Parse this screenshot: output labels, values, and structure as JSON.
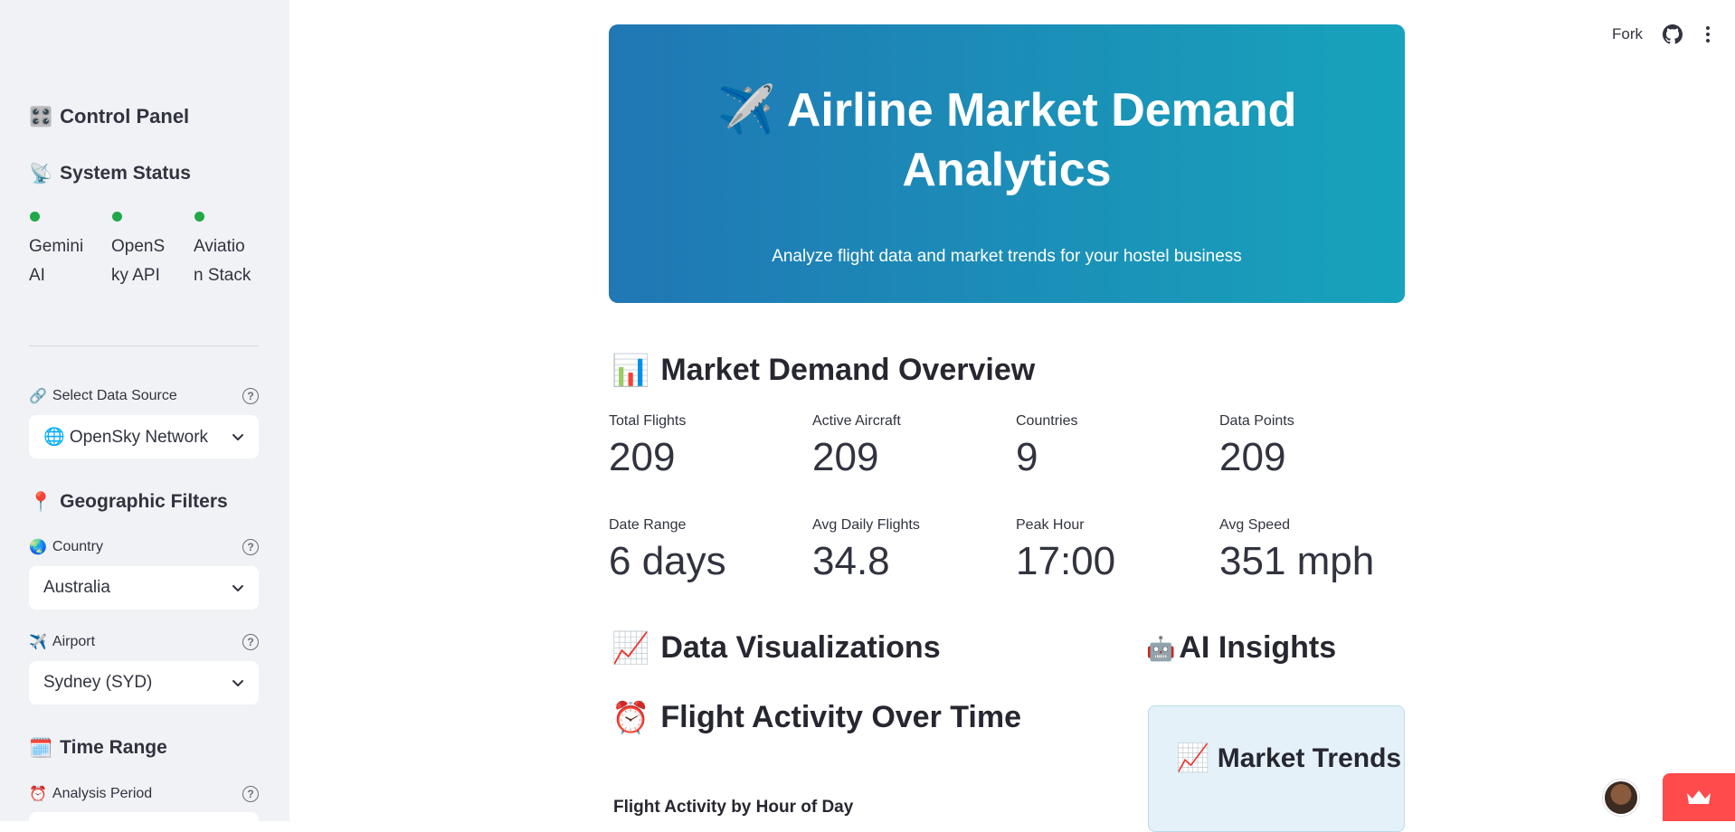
{
  "topbar": {
    "fork_label": "Fork"
  },
  "sidebar": {
    "title": "Control Panel",
    "title_icon": "🎛️",
    "system_status": {
      "heading": "System Status",
      "icon": "📡",
      "items": [
        {
          "label": "Gemini AI",
          "status_color": "#21a849"
        },
        {
          "label": "OpenSky API",
          "status_color": "#21a849"
        },
        {
          "label": "Aviation Stack",
          "status_color": "#21a849"
        }
      ]
    },
    "data_source": {
      "label": "Select Data Source",
      "icon": "🔗",
      "value": "🌐 OpenSky Network"
    },
    "geo": {
      "heading": "Geographic Filters",
      "icon": "📍",
      "country": {
        "label": "Country",
        "icon": "🌏",
        "value": "Australia"
      },
      "airport": {
        "label": "Airport",
        "icon": "✈️",
        "value": "Sydney (SYD)"
      }
    },
    "time": {
      "heading": "Time Range",
      "icon": "🗓️",
      "period": {
        "label": "Analysis Period",
        "icon": "⏰"
      }
    }
  },
  "hero": {
    "title": "✈️ Airline Market Demand Analytics",
    "subtitle": "Analyze flight data and market trends for your hostel business"
  },
  "overview": {
    "heading": "Market Demand Overview",
    "icon": "📊",
    "metrics": [
      {
        "label": "Total Flights",
        "value": "209"
      },
      {
        "label": "Active Aircraft",
        "value": "209"
      },
      {
        "label": "Countries",
        "value": "9"
      },
      {
        "label": "Data Points",
        "value": "209"
      },
      {
        "label": "Date Range",
        "value": "6 days"
      },
      {
        "label": "Avg Daily Flights",
        "value": "34.8"
      },
      {
        "label": "Peak Hour",
        "value": "17:00"
      },
      {
        "label": "Avg Speed",
        "value": "351 mph"
      }
    ]
  },
  "viz": {
    "heading": "Data Visualizations",
    "icon": "📈",
    "sub_heading": "Flight Activity Over Time",
    "sub_icon": "⏰",
    "chart_title": "Flight Activity by Hour of Day"
  },
  "ai": {
    "heading": "AI Insights",
    "icon": "🤖",
    "card_title": "Market Trends",
    "card_icon": "📈"
  },
  "colors": {
    "accent": "#ff4b4b",
    "status_ok": "#21a849",
    "hero_start": "#2077b4",
    "hero_end": "#17a3bb"
  }
}
